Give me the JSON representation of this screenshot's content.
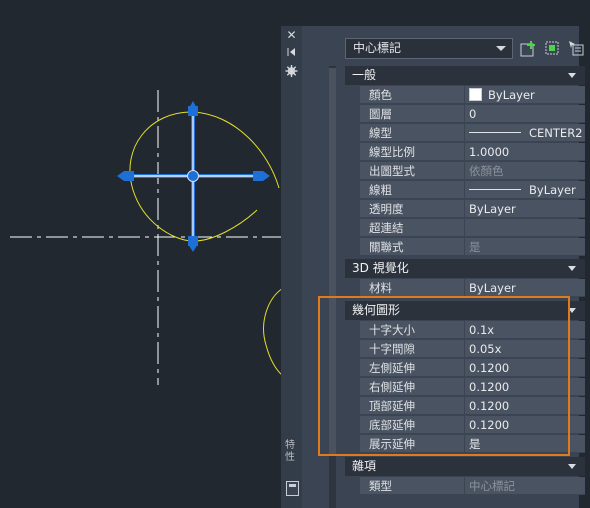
{
  "canvas": {
    "grip_color": "#1e6fd6",
    "circle_color": "#e4e02a",
    "centerline_color": "#ffffff"
  },
  "palette": {
    "side_title": "特性",
    "side_buttons": [
      "close-icon",
      "pin-icon",
      "settings-icon"
    ],
    "object_type": "中心標記",
    "toolbar_icons": [
      "toggle-pickadd-icon",
      "select-objects-icon",
      "quick-select-icon"
    ],
    "sections": {
      "general": {
        "title": "一般",
        "rows": [
          {
            "label": "顏色",
            "value": "ByLayer"
          },
          {
            "label": "圖層",
            "value": "0"
          },
          {
            "label": "線型",
            "value": "CENTER2"
          },
          {
            "label": "線型比例",
            "value": "1.0000"
          },
          {
            "label": "出圖型式",
            "value": "依顏色"
          },
          {
            "label": "線粗",
            "value": "ByLayer"
          },
          {
            "label": "透明度",
            "value": "ByLayer"
          },
          {
            "label": "超連結",
            "value": ""
          },
          {
            "label": "關聯式",
            "value": "是"
          }
        ]
      },
      "visualization": {
        "title": "3D 視覺化",
        "rows": [
          {
            "label": "材料",
            "value": "ByLayer"
          }
        ]
      },
      "geometry": {
        "title": "幾何圖形",
        "rows": [
          {
            "label": "十字大小",
            "value": "0.1x"
          },
          {
            "label": "十字間隙",
            "value": "0.05x"
          },
          {
            "label": "左側延伸",
            "value": "0.1200"
          },
          {
            "label": "右側延伸",
            "value": "0.1200"
          },
          {
            "label": "頂部延伸",
            "value": "0.1200"
          },
          {
            "label": "底部延伸",
            "value": "0.1200"
          },
          {
            "label": "展示延伸",
            "value": "是"
          }
        ]
      },
      "misc": {
        "title": "雜項",
        "rows": [
          {
            "label": "類型",
            "value": "中心標記"
          }
        ]
      }
    },
    "highlight_color": "#e07a1c"
  }
}
